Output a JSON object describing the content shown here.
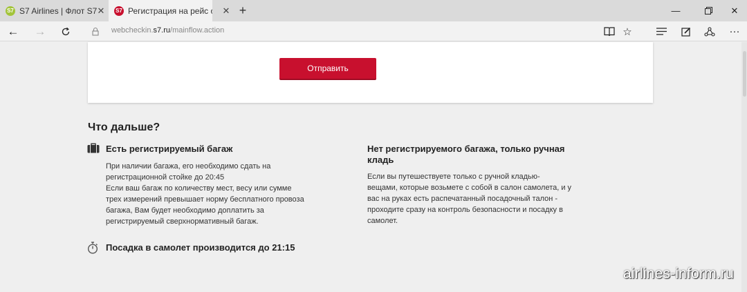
{
  "tabs": [
    {
      "label": "S7 Airlines | Флот S7",
      "favicon_text": "S7",
      "favicon_color": "#a3c43a",
      "active": false
    },
    {
      "label": "Регистрация на рейс ол",
      "favicon_text": "S7",
      "favicon_color": "#c8102e",
      "active": true
    }
  ],
  "address": {
    "prefix": "webcheckin.",
    "host": "s7.ru",
    "path": "/mainflow.action"
  },
  "form": {
    "submit_label": "Отправить"
  },
  "next": {
    "title": "Что дальше?",
    "baggage": {
      "heading": "Есть регистрируемый багаж",
      "lines": [
        "При наличии багажа, его необходимо сдать на",
        "регистрационной стойке до 20:45",
        "Если ваш багаж по количеству мест, весу или сумме",
        "трех измерений превышает норму бесплатного провоза",
        "багажа, Вам будет необходимо доплатить за",
        "регистрируемый сверхнормативный багаж."
      ]
    },
    "no_baggage": {
      "heading_lines": [
        "Нет регистрируемого багажа, только ручная",
        "кладь"
      ],
      "lines": [
        "Если вы путешествуете только с ручной кладью-",
        "вещами, которые возьмете с собой в салон самолета, и у",
        "вас на руках есть распечатанный посадочный талон -",
        "проходите сразу на контроль безопасности и посадку в",
        "самолет."
      ]
    },
    "boarding": "Посадка в самолет производится до 21:15"
  },
  "watermark": "airlines-inform.ru",
  "colors": {
    "brand": "#c8102e",
    "page_bg": "#efefef"
  }
}
